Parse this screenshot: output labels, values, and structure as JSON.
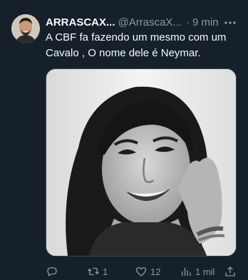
{
  "tweet": {
    "author_name": "ARRASCAX...",
    "author_handle": "@ArrascaX...",
    "separator": "·",
    "time": "9 min",
    "text": "A CBF fa fazendo um mesmo com um Cavalo , O nome dele é Neymar.",
    "media_icon": "photo",
    "actions": {
      "reply_count": "",
      "retweet_count": "1",
      "like_count": "12",
      "views_count": "1 mil"
    }
  },
  "colors": {
    "background": "#15202b",
    "text_primary": "#f7f9f9",
    "text_secondary": "#8b98a5",
    "border": "#38444d"
  },
  "icons": {
    "more": "more-dots-icon",
    "reply": "reply-icon",
    "retweet": "retweet-icon",
    "like": "heart-icon",
    "views": "views-icon",
    "share": "share-icon"
  }
}
